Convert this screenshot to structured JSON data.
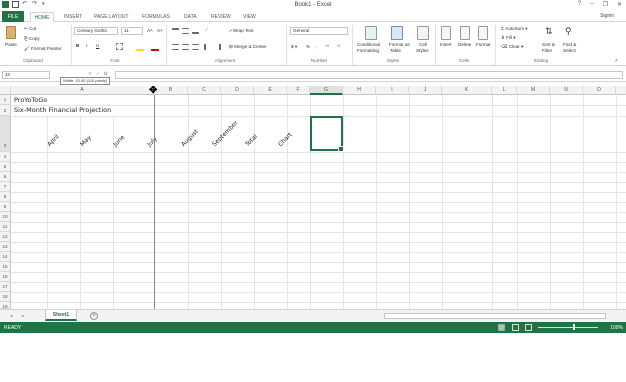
{
  "window": {
    "title": "Book1 - Excel",
    "controls": [
      "?",
      "–",
      "❐",
      "✕"
    ]
  },
  "tabs": [
    "FILE",
    "HOME",
    "INSERT",
    "PAGE LAYOUT",
    "FORMULAS",
    "DATA",
    "REVIEW",
    "VIEW"
  ],
  "active_tab": "HOME",
  "user": "Signin",
  "ribbon": {
    "clipboard": {
      "paste": "Paste",
      "cut": "Cut",
      "copy": "Copy",
      "format_painter": "Format Painter",
      "label": "Clipboard"
    },
    "font": {
      "font_name": "Century Gothic",
      "font_size": "11",
      "bold": "B",
      "italic": "I",
      "underline": "U",
      "label": "Font"
    },
    "alignment": {
      "wrap_text": "Wrap Text",
      "merge_center": "Merge & Center",
      "label": "Alignment"
    },
    "number": {
      "format": "General",
      "label": "Number"
    },
    "styles": {
      "conditional": "Conditional",
      "conditional2": "Formatting",
      "format_as": "Format as",
      "format_as2": "Table",
      "cell": "Cell",
      "cell2": "Styles",
      "label": "Styles"
    },
    "cells": {
      "insert": "Insert",
      "delete": "Delete",
      "format": "Format",
      "label": "Cells"
    },
    "editing": {
      "autosum": "AutoSum",
      "fill": "Fill",
      "clear": "Clear",
      "sort": "Sort &",
      "sort2": "Filter",
      "find": "Find &",
      "find2": "Select",
      "label": "Editing"
    }
  },
  "formula_bar": {
    "name_box": "J3",
    "tooltip": "Width: 10.00 (110 pixels)"
  },
  "grid": {
    "columns": [
      "A",
      "B",
      "C",
      "D",
      "E",
      "F",
      "G",
      "H",
      "I",
      "J",
      "K",
      "L",
      "M",
      "N",
      "O"
    ],
    "selected_column": "G",
    "rows": [
      "1",
      "2",
      "3",
      "4",
      "5",
      "6",
      "7",
      "8",
      "9",
      "10",
      "11",
      "12",
      "13",
      "14",
      "15",
      "16",
      "17",
      "18",
      "19"
    ],
    "selected_row": "3",
    "a1": "ProYoToGo",
    "a2": "Six-Month Financial Projection",
    "row3_headers": [
      "April",
      "May",
      "June",
      "July",
      "August",
      "September",
      "Total",
      "Chart"
    ]
  },
  "sheets": [
    "Sheet1"
  ],
  "status": {
    "ready": "READY",
    "zoom": "100%"
  },
  "colors": {
    "accent": "#217346"
  }
}
